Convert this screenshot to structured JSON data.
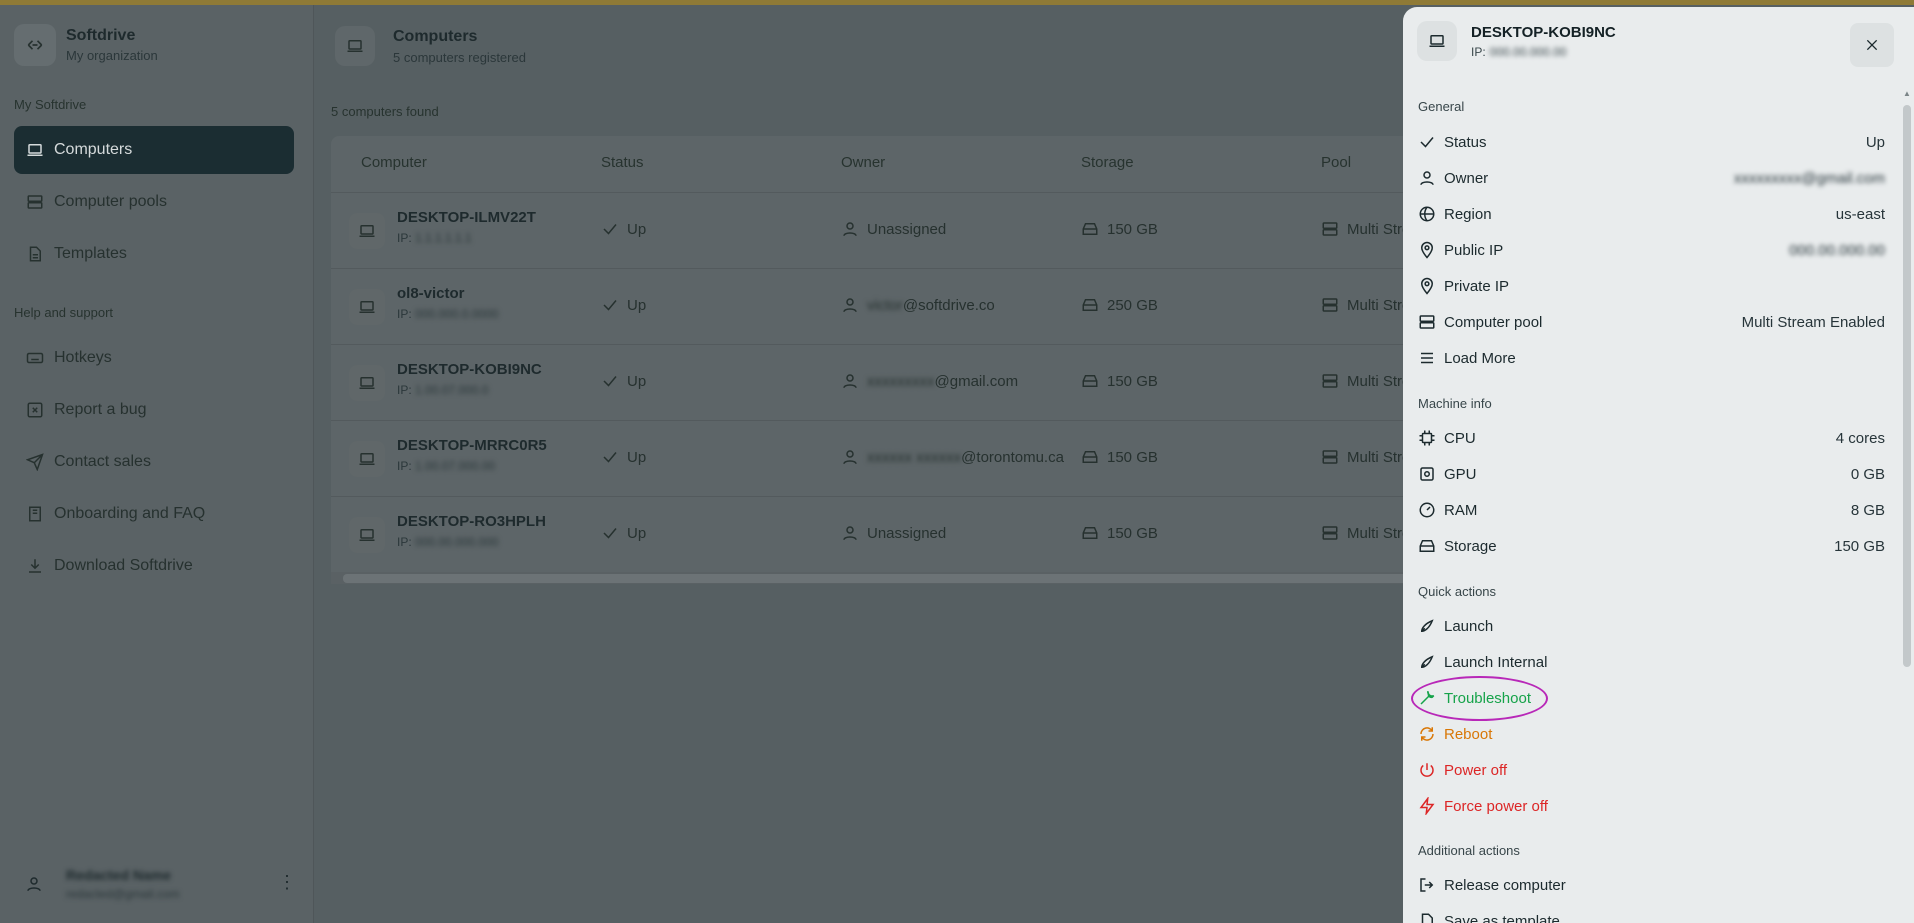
{
  "sidebar": {
    "org_name": "Softdrive",
    "org_sub": "My organization",
    "section_my": "My Softdrive",
    "nav": [
      {
        "label": "Computers",
        "icon": "laptop-icon"
      },
      {
        "label": "Computer pools",
        "icon": "server-icon"
      },
      {
        "label": "Templates",
        "icon": "file-icon"
      }
    ],
    "section_help": "Help and support",
    "help": [
      {
        "label": "Hotkeys",
        "icon": "keyboard-icon"
      },
      {
        "label": "Report a bug",
        "icon": "bug-icon"
      },
      {
        "label": "Contact sales",
        "icon": "send-icon"
      },
      {
        "label": "Onboarding and FAQ",
        "icon": "book-icon"
      },
      {
        "label": "Download Softdrive",
        "icon": "download-icon"
      }
    ],
    "user": {
      "name": "Redacted Name",
      "email": "redacted@gmail.com"
    }
  },
  "main": {
    "title": "Computers",
    "subtitle": "5 computers registered",
    "found": "5 computers found",
    "columns": [
      "Computer",
      "Status",
      "Owner",
      "Storage",
      "Pool"
    ],
    "rows": [
      {
        "name": "DESKTOP-ILMV22T",
        "ip": "IP: ",
        "ip_blur": "1.1.1.1.1.1",
        "status": "Up",
        "owner": "Unassigned",
        "owner_blur": "",
        "storage": "150 GB",
        "pool": "Multi Stream Enabled"
      },
      {
        "name": "ol8-victor",
        "ip": "IP: ",
        "ip_blur": "000.000.0.0000",
        "status": "Up",
        "owner": "@softdrive.co",
        "owner_blur": "victor",
        "storage": "250 GB",
        "pool": "Multi Stream Enabled"
      },
      {
        "name": "DESKTOP-KOBI9NC",
        "ip": "IP: ",
        "ip_blur": "1.00.07.000.0",
        "status": "Up",
        "owner": "@gmail.com",
        "owner_blur": "xxxxxxxxx",
        "storage": "150 GB",
        "pool": "Multi Stream Enabled"
      },
      {
        "name": "DESKTOP-MRRC0R5",
        "ip": "IP: ",
        "ip_blur": "1.00.07.000.00",
        "status": "Up",
        "owner": "@torontomu.ca",
        "owner_blur": "xxxxxx xxxxxx",
        "storage": "150 GB",
        "pool": "Multi Stream Enabled"
      },
      {
        "name": "DESKTOP-RO3HPLH",
        "ip": "IP: ",
        "ip_blur": "000.00.000.000",
        "status": "Up",
        "owner": "Unassigned",
        "owner_blur": "",
        "storage": "150 GB",
        "pool": "Multi Stream Enabled"
      }
    ]
  },
  "drawer": {
    "title": "DESKTOP-KOBI9NC",
    "ip_label": "IP:",
    "ip_blur": "000.00.000.00",
    "general_label": "General",
    "general": [
      {
        "label": "Status",
        "value": "Up",
        "icon": "check-icon"
      },
      {
        "label": "Owner",
        "value": "xxxxxxxxx@gmail.com",
        "icon": "user-icon"
      },
      {
        "label": "Region",
        "value": "us-east",
        "icon": "globe-icon"
      },
      {
        "label": "Public IP",
        "value": "000.00.000.00",
        "icon": "map-pin-icon"
      },
      {
        "label": "Private IP",
        "value": "",
        "icon": "map-pin-icon"
      },
      {
        "label": "Computer pool",
        "value": "Multi Stream Enabled",
        "icon": "server-icon"
      },
      {
        "label": "Load More",
        "value": "",
        "icon": "menu-icon"
      }
    ],
    "machine_label": "Machine info",
    "machine": [
      {
        "label": "CPU",
        "value": "4 cores",
        "icon": "cpu-icon"
      },
      {
        "label": "GPU",
        "value": "0 GB",
        "icon": "gpu-icon"
      },
      {
        "label": "RAM",
        "value": "8 GB",
        "icon": "gauge-icon"
      },
      {
        "label": "Storage",
        "value": "150 GB",
        "icon": "hard-drive-icon"
      }
    ],
    "quick_label": "Quick actions",
    "quick": [
      {
        "label": "Launch",
        "icon": "rocket-icon",
        "tone": ""
      },
      {
        "label": "Launch Internal",
        "icon": "rocket-icon",
        "tone": ""
      },
      {
        "label": "Troubleshoot",
        "icon": "wrench-icon",
        "tone": "green"
      },
      {
        "label": "Reboot",
        "icon": "refresh-icon",
        "tone": "orange"
      },
      {
        "label": "Power off",
        "icon": "power-icon",
        "tone": "red"
      },
      {
        "label": "Force power off",
        "icon": "zap-icon",
        "tone": "red"
      }
    ],
    "additional_label": "Additional actions",
    "additional": [
      {
        "label": "Release computer",
        "icon": "logout-icon"
      },
      {
        "label": "Save as template",
        "icon": "file-icon"
      }
    ]
  },
  "colors": {
    "accent_dark": "#1b2d32",
    "success": "#16a34a",
    "warning": "#d97706",
    "danger": "#dc2626",
    "highlight": "#b828b8"
  }
}
